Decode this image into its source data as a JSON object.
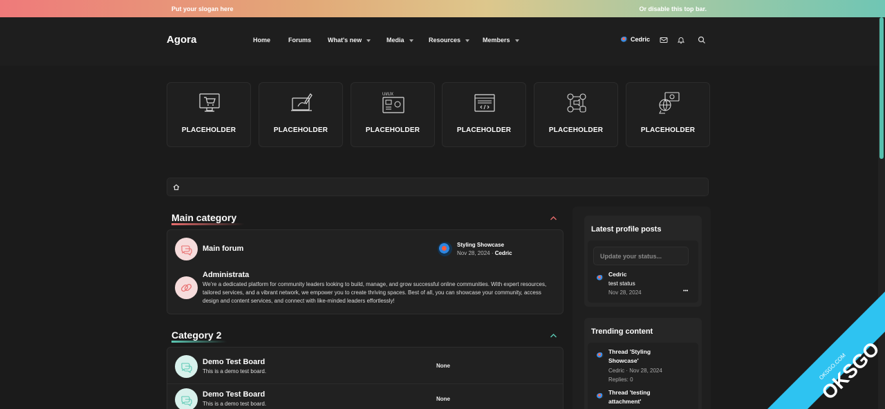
{
  "topbar": {
    "slogan": "Put your slogan here",
    "disable": "Or disable this top bar."
  },
  "nav": {
    "logo": "Agora",
    "links": [
      "Home",
      "Forums",
      "What's new",
      "Media",
      "Resources",
      "Members"
    ],
    "user": "Cedric"
  },
  "tiles": [
    {
      "label": "PLACEHOLDER",
      "icon": "shopping-cart-monitor-icon"
    },
    {
      "label": "PLACEHOLDER",
      "icon": "design-tablet-icon"
    },
    {
      "label": "PLACEHOLDER",
      "icon": "ui-ux-icon",
      "icon_text": "UI/UX"
    },
    {
      "label": "PLACEHOLDER",
      "icon": "web-code-icon"
    },
    {
      "label": "PLACEHOLDER",
      "icon": "social-media-icon"
    },
    {
      "label": "PLACEHOLDER",
      "icon": "money-globe-icon"
    }
  ],
  "categories": [
    {
      "title": "Main category",
      "accent": "#e86d6d",
      "forums": [
        {
          "name": "Main forum",
          "last_thread": "Styling Showcase",
          "last_date": "Nov 28, 2024",
          "last_user": "Cedric"
        },
        {
          "name": "Administrata",
          "desc": "We're a dedicated platform for community leaders looking to build, manage, and grow successful online communities. With expert resources, tailored services, and a vibrant network, we empower you to create thriving spaces. Best of all, you can showcase your community, access design and content services, and connect with like-minded leaders effortlessly!"
        }
      ]
    },
    {
      "title": "Category 2",
      "accent": "#5cc9b4",
      "forums": [
        {
          "name": "Demo Test Board",
          "desc": "This is a demo test board.",
          "last": "None"
        },
        {
          "name": "Demo Test Board",
          "desc": "This is a demo test board.",
          "last": "None"
        }
      ]
    }
  ],
  "sidebar": {
    "profile_posts": {
      "title": "Latest profile posts",
      "placeholder": "Update your status...",
      "post_user": "Cedric",
      "post_text": "test status",
      "post_date": "Nov 28, 2024",
      "more": "•••"
    },
    "trending": {
      "title": "Trending content",
      "items": [
        {
          "line1": "Thread 'Styling",
          "line2": "Showcase'",
          "meta": "Cedric · Nov 28, 2024",
          "replies": "Replies: 0"
        },
        {
          "line1": "Thread 'testing",
          "line2": "attachment'"
        }
      ]
    }
  },
  "watermark": {
    "site": "OKSGO.COM",
    "brand": "OKSGO"
  }
}
